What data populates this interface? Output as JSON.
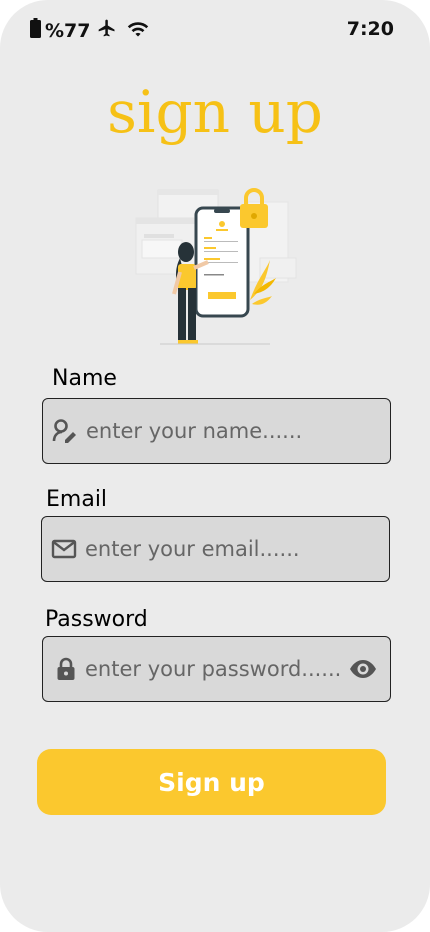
{
  "status_bar": {
    "battery_text": "%77",
    "time": "7:20",
    "icons": [
      "battery-icon",
      "airplane-icon",
      "wifi-icon"
    ]
  },
  "title": "sign up",
  "illustration": {
    "name": "signup-illustration"
  },
  "form": {
    "name": {
      "label": "Name",
      "placeholder": "enter your name......",
      "value": "",
      "icon": "user-edit-icon"
    },
    "email": {
      "label": "Email",
      "placeholder": "enter your email......",
      "value": "",
      "icon": "mail-icon"
    },
    "password": {
      "label": "Password",
      "placeholder": "enter your password......",
      "value": "",
      "icon": "lock-icon",
      "toggle_icon": "eye-icon"
    }
  },
  "submit": {
    "label": "Sign up"
  },
  "colors": {
    "accent": "#fbc82e",
    "title": "#f6c116",
    "background": "#ebebeb",
    "field_background": "#d9d9d9"
  }
}
